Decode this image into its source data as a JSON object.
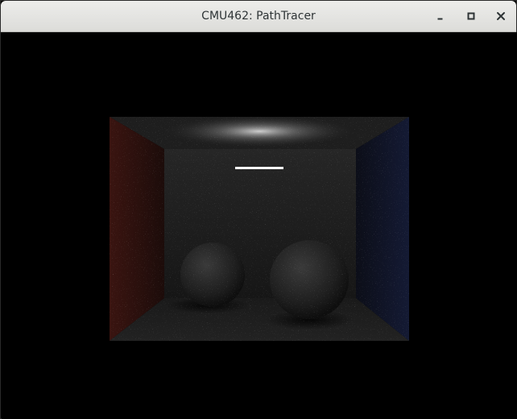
{
  "window": {
    "title": "CMU462: PathTracer",
    "buttons": {
      "minimize_icon": "minimize-icon",
      "maximize_icon": "maximize-icon",
      "close_icon": "close-icon"
    }
  },
  "scene": {
    "description_icon": "cornell-box-render",
    "colors": {
      "left_wall": "#3a1410",
      "right_wall": "#141a34",
      "neutral": "#222222",
      "light": "#ffffff"
    }
  }
}
